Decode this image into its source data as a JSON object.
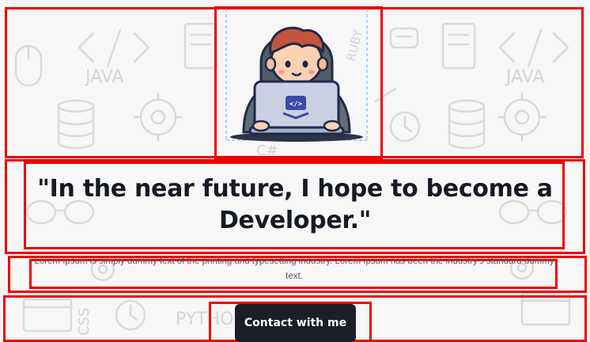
{
  "hero": {
    "background_words": [
      "JAVA",
      "JAVA",
      "RUBY",
      "C#",
      "PYTHON",
      "CSS"
    ],
    "illustration": {
      "icon_name": "developer-at-laptop-icon",
      "laptop_logo": "</>"
    },
    "headline": "\"In the near future, I hope to become a Developer.\"",
    "description": "Lorem Ipsum is simply dummy text of the printing and typesetting industry. Lorem Ipsum has been the industry's standard dummy text.",
    "cta_label": "Contact with me"
  },
  "colors": {
    "background": "#f7f7f7",
    "pattern": "#dcdcdc",
    "text": "#161a24",
    "muted_text": "#555b62",
    "button": "#1b1e26",
    "annotation_box": "#ee0000"
  }
}
